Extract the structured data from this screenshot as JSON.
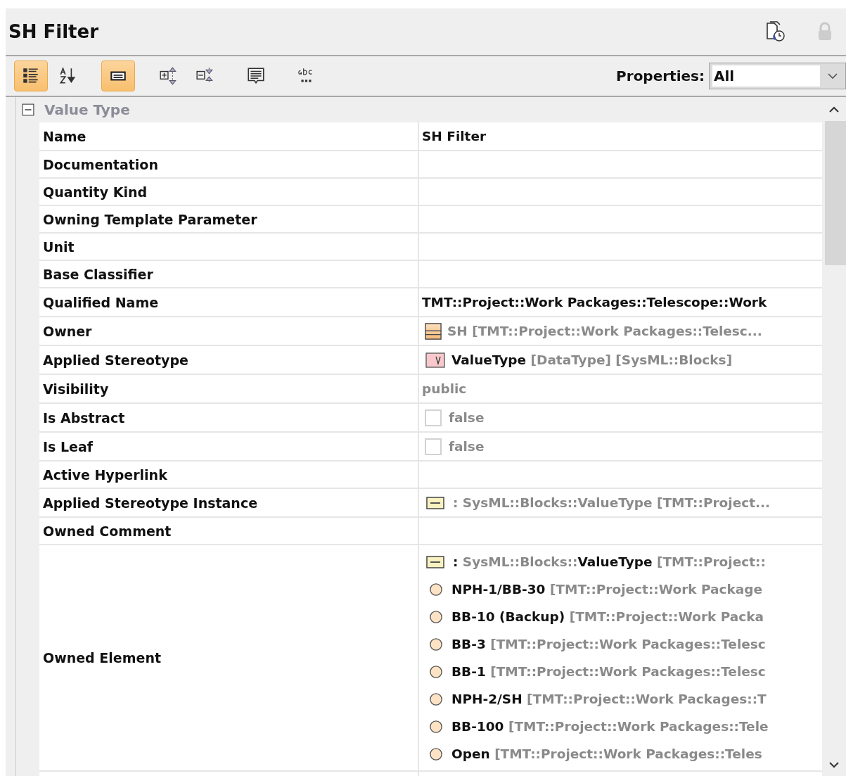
{
  "panel": {
    "title": "SH Filter"
  },
  "toolbar": {
    "buttons": [
      {
        "selected": true
      },
      {
        "selected": false
      },
      {
        "selected": true
      },
      {
        "selected": false
      },
      {
        "selected": false
      },
      {
        "selected": false
      },
      {
        "selected": false
      }
    ],
    "properties_label": "Properties:",
    "properties_value": "All"
  },
  "group": {
    "label": "Value Type",
    "expanded": true
  },
  "rows": [
    {
      "name": "Name",
      "values": [
        {
          "kind": "bold",
          "text": "SH Filter"
        }
      ]
    },
    {
      "name": "Documentation",
      "values": []
    },
    {
      "name": "Quantity Kind",
      "values": []
    },
    {
      "name": "Owning Template Parameter",
      "values": []
    },
    {
      "name": "Unit",
      "values": []
    },
    {
      "name": "Base Classifier",
      "values": []
    },
    {
      "name": "Qualified Name",
      "values": [
        {
          "kind": "bold",
          "text": "TMT::Project::Work Packages::Telescope::Work"
        }
      ]
    },
    {
      "name": "Owner",
      "values": [
        {
          "kind": "block",
          "text": "SH [TMT::Project::Work Packages::Telesc..."
        }
      ]
    },
    {
      "name": "Applied Stereotype",
      "values": [
        {
          "kind": "stereotype",
          "text": "**ValueType** [DataType] [SysML::Blocks]"
        }
      ]
    },
    {
      "name": "Visibility",
      "values": [
        {
          "kind": "plain",
          "text": "public"
        }
      ]
    },
    {
      "name": "Is Abstract",
      "values": [
        {
          "kind": "checkbox",
          "checked": false,
          "text": "false"
        }
      ]
    },
    {
      "name": "Is Leaf",
      "values": [
        {
          "kind": "checkbox",
          "checked": false,
          "text": "false"
        }
      ]
    },
    {
      "name": "Active Hyperlink",
      "values": []
    },
    {
      "name": "Applied Stereotype Instance",
      "values": [
        {
          "kind": "instance",
          "text": ": SysML::Blocks::ValueType [TMT::Project..."
        }
      ]
    },
    {
      "name": "Owned Comment",
      "values": []
    },
    {
      "name": "Owned Element",
      "values": [
        {
          "kind": "instance",
          "text": "**:** SysML::Blocks::**ValueType** [TMT::Project::"
        },
        {
          "kind": "part",
          "text": "**NPH-1/BB-30** [TMT::Project::Work Package"
        },
        {
          "kind": "part",
          "text": "**BB-10 (Backup)** [TMT::Project::Work Packa"
        },
        {
          "kind": "part",
          "text": "**BB-3** [TMT::Project::Work Packages::Telesc"
        },
        {
          "kind": "part",
          "text": "**BB-1** [TMT::Project::Work Packages::Telesc"
        },
        {
          "kind": "part",
          "text": "**NPH-2/SH** [TMT::Project::Work Packages::T"
        },
        {
          "kind": "part",
          "text": "**BB-100** [TMT::Project::Work Packages::Tele"
        },
        {
          "kind": "part",
          "text": "**Open** [TMT::Project::Work Packages::Teles"
        }
      ]
    }
  ]
}
